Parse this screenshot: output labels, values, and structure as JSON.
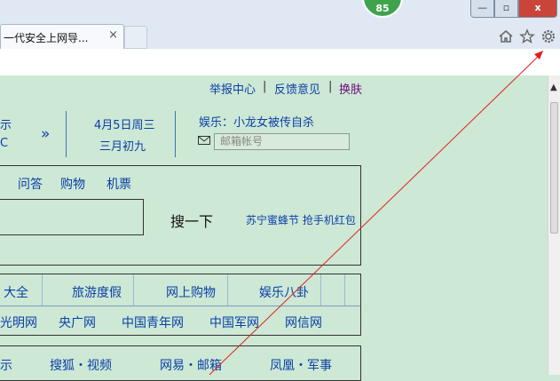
{
  "browser": {
    "tab_title": "一代安全上网导...",
    "tab_close": "×",
    "badge_count": "85",
    "win_min": "—",
    "win_max": "▫",
    "win_close": "x",
    "home_icon": "home-icon",
    "favorites_icon": "star-icon",
    "tools_icon": "gear-icon"
  },
  "topbar": {
    "report": "举报中心",
    "feedback": "反馈意见",
    "skin": "换肤",
    "sep": "|"
  },
  "header": {
    "cut_1": "示",
    "cut_2": "C",
    "arrow": "»",
    "date": "4月5日周三",
    "lunar": "三月初九",
    "news": "娱乐：小龙女被传自杀",
    "mail_placeholder": "邮箱帐号"
  },
  "search": {
    "tabs": [
      "问答",
      "购物",
      "机票"
    ],
    "button": "搜一下",
    "promo": "苏宁蜜蜂节 抢手机红包"
  },
  "nav_row1": [
    "大全",
    "旅游度假",
    "网上购物",
    "娱乐八卦"
  ],
  "nav_row2": [
    "光明网",
    "央广网",
    "中国青年网",
    "中国军网",
    "网信网"
  ],
  "sites": [
    "搜狐・视频",
    "网易・邮箱",
    "凤凰・军事"
  ],
  "sites_cut": "示"
}
